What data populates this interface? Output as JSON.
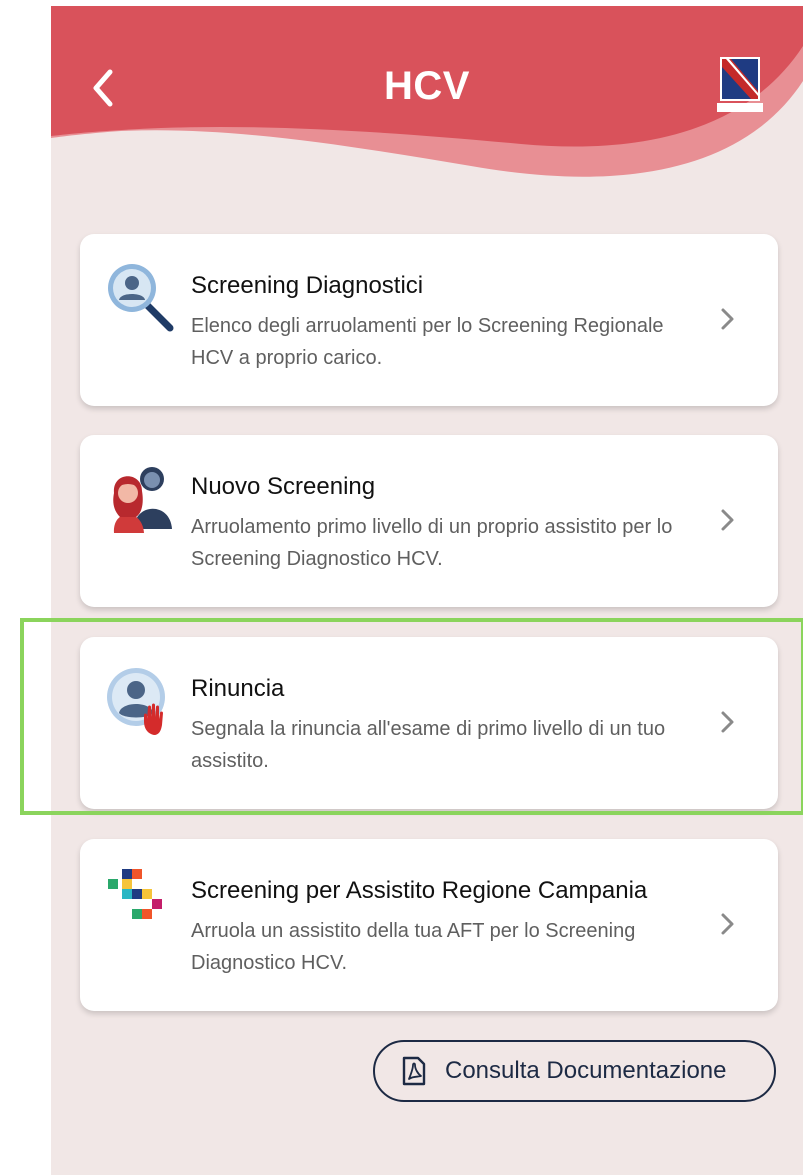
{
  "header": {
    "title": "HCV",
    "back_icon": "chevron-left-icon",
    "logo_text": "REGIONE CAMPANIA",
    "color_primary": "#d9525b",
    "color_secondary": "#e88f94"
  },
  "cards": [
    {
      "title": "Screening Diagnostici",
      "description": "Elenco degli arruolamenti per lo Screening Regionale HCV a proprio carico.",
      "icon": "magnifier-user-icon"
    },
    {
      "title": "Nuovo Screening",
      "description": "Arruolamento primo livello di un proprio assistito per lo Screening Diagnostico HCV.",
      "icon": "people-icon"
    },
    {
      "title": "Rinuncia",
      "description": "Segnala la rinuncia all'esame di primo livello di un tuo assistito.",
      "icon": "user-stop-icon"
    },
    {
      "title": "Screening per Assistito Regione Campania",
      "description": "Arruola un assistito della tua AFT per lo Screening Diagnostico HCV.",
      "icon": "pixel-logo-icon"
    }
  ],
  "documentation_button": {
    "label": "Consulta Documentazione",
    "icon": "pdf-icon"
  },
  "colors": {
    "background": "#f1e7e6",
    "highlight": "#8bd45c",
    "button_border": "#1d2a44"
  }
}
